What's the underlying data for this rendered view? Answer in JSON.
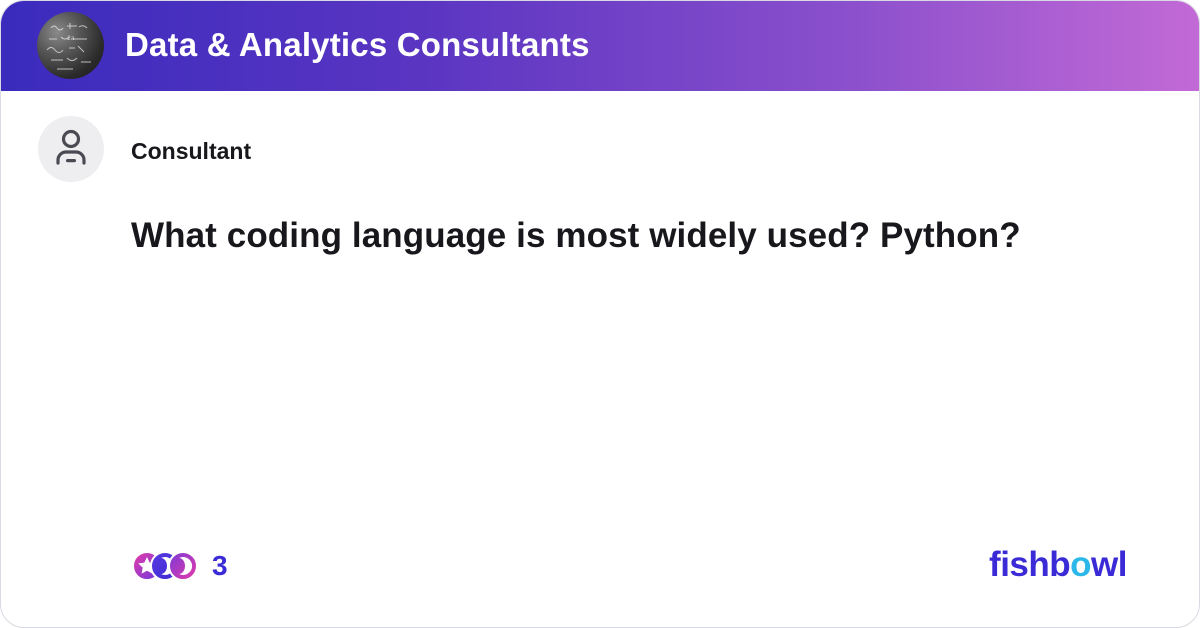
{
  "header": {
    "group_avatar_icon": "chalkboard-photo-avatar",
    "title": "Data & Analytics Consultants"
  },
  "post": {
    "author_icon": "user-icon",
    "author": "Consultant",
    "question": "What coding language is most widely used? Python?"
  },
  "reactions": {
    "icons": [
      "star-badge-icon",
      "crescent-badge-icon",
      "crescent-badge-icon"
    ],
    "count": "3"
  },
  "brand": {
    "part1": "fishb",
    "part2": "o",
    "part3": "wl"
  },
  "colors": {
    "header_gradient_start": "#3a2bbd",
    "header_gradient_end": "#c26ad6",
    "accent": "#3a2bd6",
    "brand_o": "#2bb8e8"
  }
}
